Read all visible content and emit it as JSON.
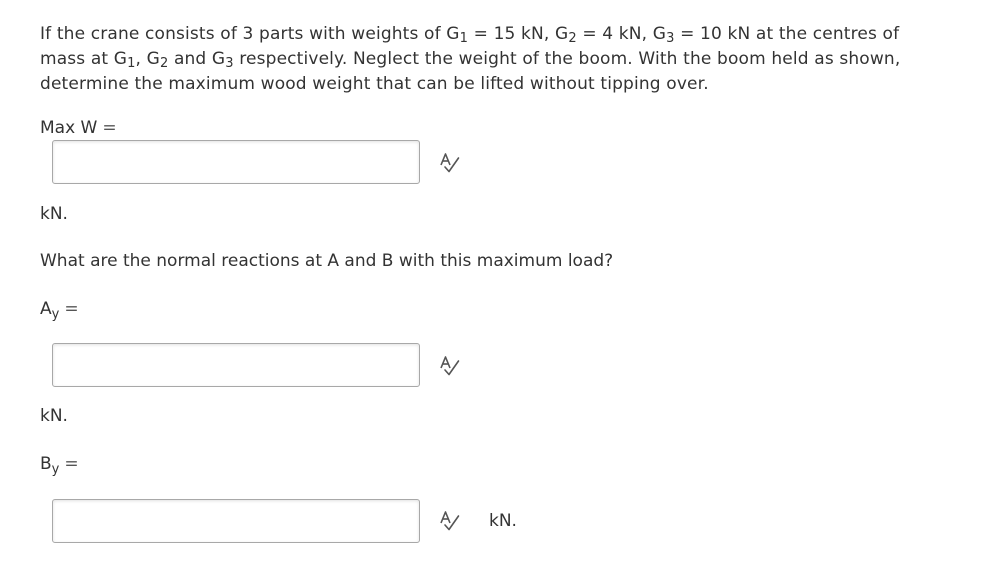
{
  "problem": {
    "line1_part1": "If the crane consists of 3 parts with weights of G",
    "sub1": "1",
    "line1_part2": " = 15 kN, G",
    "sub2": "2",
    "line1_part3": " = 4 kN, G",
    "sub3": "3",
    "line1_part4": " = 10 kN at the centres of mass at G",
    "sub4": "1",
    "line1_part5": ", G",
    "sub5": "2",
    "line1_part6": " and G",
    "sub6": "3",
    "line1_part7": " respectively. Neglect the weight of the boom. With the boom held as shown, determine the maximum wood weight that can be lifted without tipping over."
  },
  "max_w": {
    "label": "Max W",
    "equals": "=",
    "value": "",
    "unit": "kN."
  },
  "question2": "What are the normal reactions at A and B with this maximum load?",
  "ay": {
    "label_main": "A",
    "label_sub": "y",
    "equals": "=",
    "value": "",
    "unit": "kN."
  },
  "by": {
    "label_main": "B",
    "label_sub": "y",
    "equals": "=",
    "value": "",
    "unit": "kN."
  },
  "icons": {
    "spell_check": "spell-check-icon"
  },
  "colors": {
    "text": "#333333",
    "border": "#a8a8a8"
  }
}
